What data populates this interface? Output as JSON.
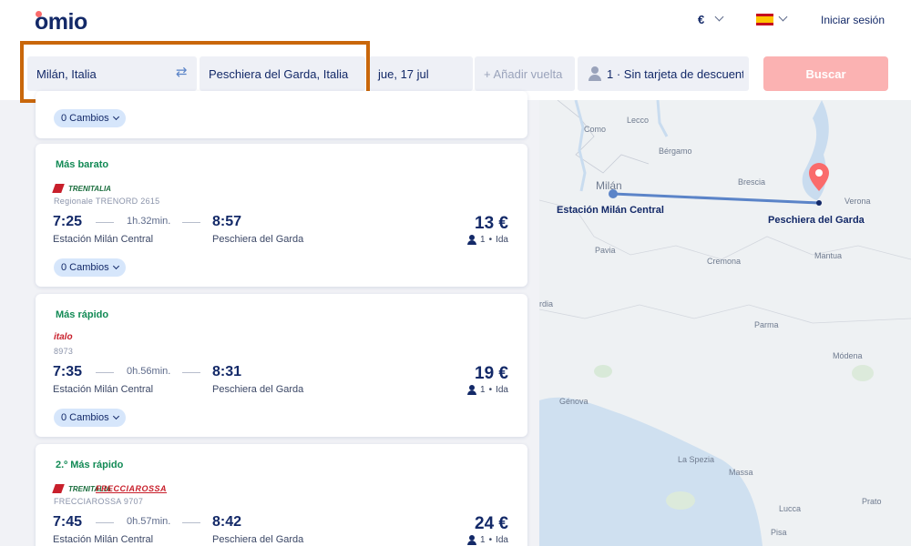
{
  "header": {
    "logo": "omio",
    "currency": "€",
    "login": "Iniciar sesión"
  },
  "search": {
    "origin": "Milán, Italia",
    "destination": "Peschiera del Garda, Italia",
    "date": "jue, 17 jul",
    "return_placeholder": "+ Añadir vuelta",
    "passengers": "1 · Sin tarjeta de descuento",
    "search_button": "Buscar"
  },
  "colors": {
    "brand_navy": "#132968",
    "accent_coral": "#fa6b6b",
    "tag_green": "#128a55",
    "highlight_orange": "#c9670b"
  },
  "results": {
    "top_card_changes": "0 Cambios",
    "items": [
      {
        "tag": "Más barato",
        "operator": "TRENITALIA",
        "train": "Regionale TRENORD 2615",
        "dep": "7:25",
        "duration": "1h.32min.",
        "arr": "8:57",
        "from": "Estación Milán Central",
        "to": "Peschiera del Garda",
        "price": "13 €",
        "pax": "1",
        "trip": "Ida",
        "changes": "0 Cambios"
      },
      {
        "tag": "Más rápido",
        "operator": "italo",
        "train": "8973",
        "dep": "7:35",
        "duration": "0h.56min.",
        "arr": "8:31",
        "from": "Estación Milán Central",
        "to": "Peschiera del Garda",
        "price": "19 €",
        "pax": "1",
        "trip": "Ida",
        "changes": "0 Cambios"
      },
      {
        "tag": "2.º Más rápido",
        "operator": "TRENITALIA",
        "operator2": "FRECCIAROSSA",
        "train": "FRECCIAROSSA 9707",
        "dep": "7:45",
        "duration": "0h.57min.",
        "arr": "8:42",
        "from": "Estación Milán Central",
        "to": "Peschiera del Garda",
        "price": "24 €",
        "pax": "1",
        "trip": "Ida"
      }
    ]
  },
  "map": {
    "origin_label": "Estación Milán Central",
    "destination_label": "Peschiera del Garda",
    "places": [
      "Lecco",
      "Como",
      "Bérgamo",
      "Milán",
      "Brescia",
      "Verona",
      "Pavia",
      "Cremona",
      "Mantua",
      "Parma",
      "Módena",
      "Génova",
      "La Spezia",
      "Massa",
      "Lucca",
      "Prato",
      "Pisa",
      "rdia"
    ]
  }
}
